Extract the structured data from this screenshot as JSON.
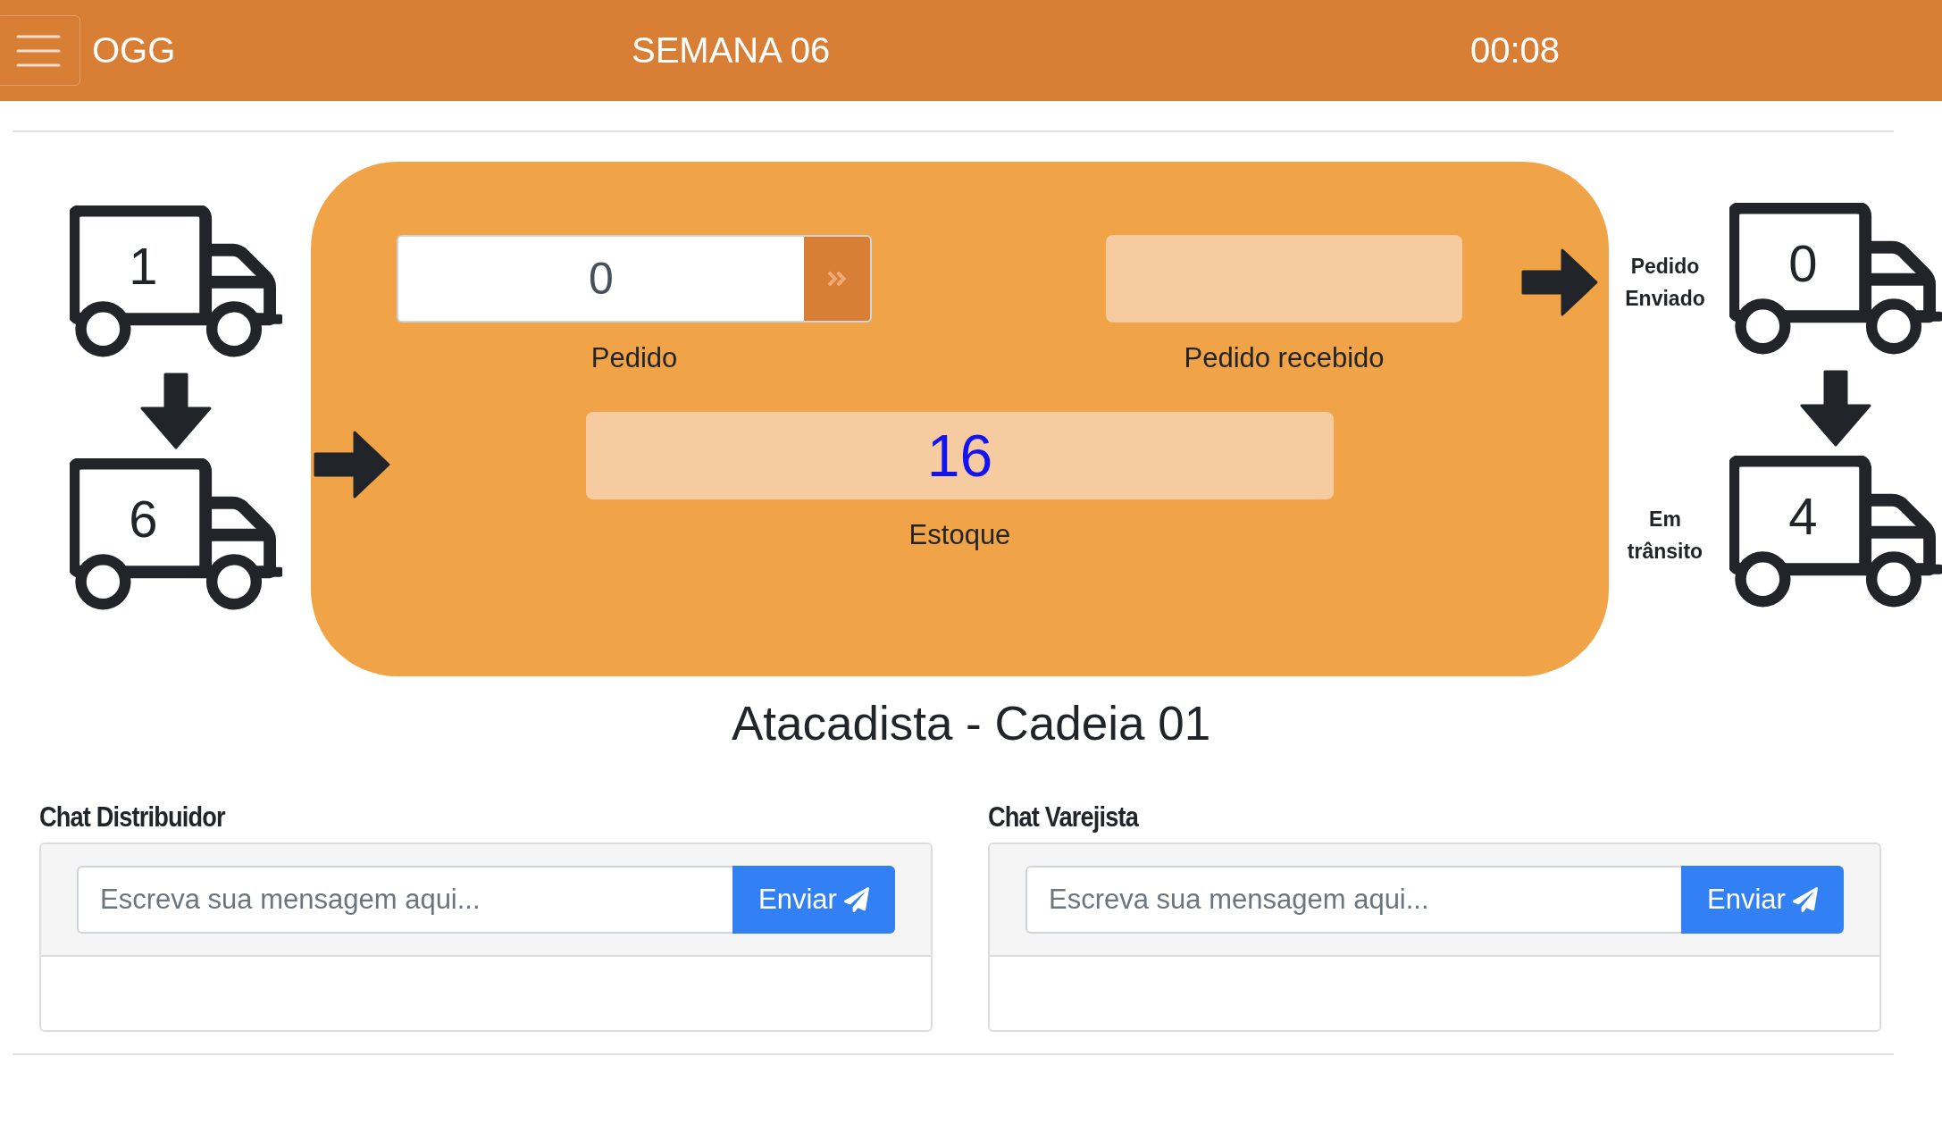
{
  "header": {
    "brand": "OGG",
    "week": "SEMANA 06",
    "timer": "00:08"
  },
  "incoming_trucks": [
    {
      "count": "1"
    },
    {
      "count": "6"
    }
  ],
  "order": {
    "value": "0",
    "label": "Pedido"
  },
  "received": {
    "label": "Pedido recebido"
  },
  "stock": {
    "value": "16",
    "label": "Estoque"
  },
  "outgoing_trucks": [
    {
      "label": "Pedido Enviado",
      "count": "0"
    },
    {
      "label": "Em trânsito",
      "count": "4"
    }
  ],
  "role_title": "Atacadista - Cadeia 01",
  "chats": [
    {
      "title": "Chat Distribuidor",
      "placeholder": "Escreva sua mensagem aqui...",
      "button": "Enviar"
    },
    {
      "title": "Chat Varejista",
      "placeholder": "Escreva sua mensagem aqui...",
      "button": "Enviar"
    }
  ]
}
